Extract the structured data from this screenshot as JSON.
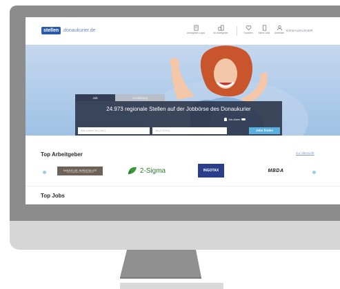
{
  "nav": {
    "logo_box": "stellen",
    "logo_rest": ".donaukurier.de",
    "items": [
      {
        "icon": "building-icon",
        "label": "Arbeitgeber-Logos"
      },
      {
        "icon": "company-icon",
        "label": "für Arbeitgeber"
      },
      {
        "icon": "heart-icon",
        "label": "Favoriten"
      },
      {
        "icon": "document-icon",
        "label": "Meine Jobs"
      },
      {
        "icon": "user-icon",
        "label": "Anmelden"
      }
    ],
    "brand": "DONAUKURIER"
  },
  "search": {
    "tab_job": "Job",
    "tab_ausbildung": "Ausbildung",
    "headline": "24.973 regionale Stellen auf der Jobbörse des Donaukurier",
    "filter_label": "Job-Alarm",
    "what_placeholder": "Was suchen Sie (Job?)",
    "where_placeholder": "Wo (PLZ/Ort)",
    "button": "Jobs finden"
  },
  "employers": {
    "title": "Top Arbeitgeber",
    "link": "zur Übersicht",
    "logos": [
      {
        "name": "KANZLEI DR. BURGSTALLER",
        "sub": "RECHTSANWÄLTE STEUERBERATER"
      },
      {
        "name": "2-Sigma"
      },
      {
        "name": "INGOTAX"
      },
      {
        "name": "MBDA"
      }
    ]
  },
  "jobs": {
    "title": "Top Jobs"
  },
  "colors": {
    "brand_blue": "#2b5aa8",
    "button_blue": "#5ab0e0",
    "hero_bg": "#aecbe9",
    "monitor_bezel": "#8c8c8c"
  }
}
